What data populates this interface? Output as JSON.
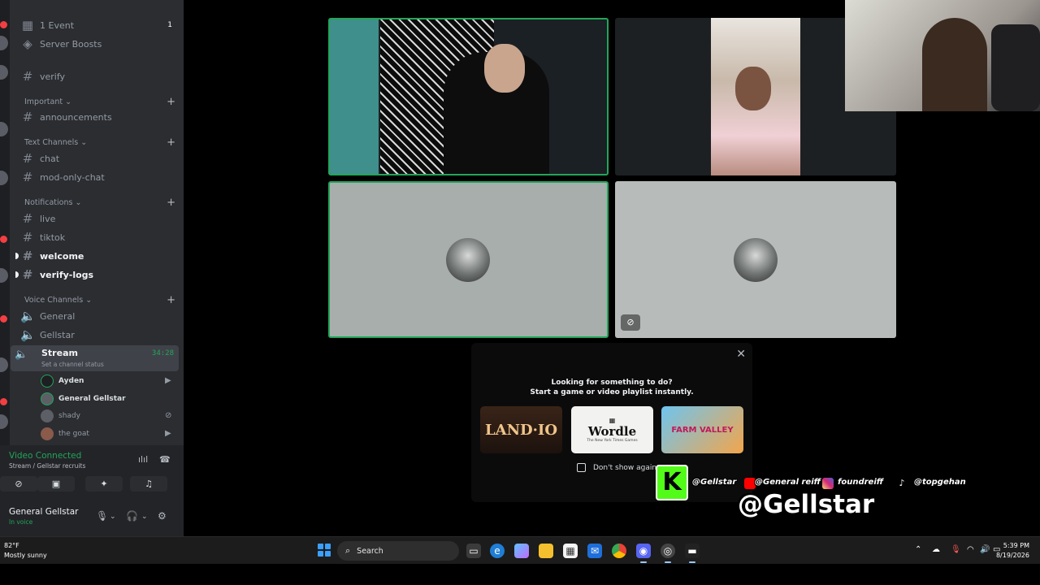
{
  "sidebar": {
    "top_items": [
      {
        "label": "1 Event",
        "count": "1"
      },
      {
        "label": "Server Boosts"
      }
    ],
    "verify": "verify",
    "categories": {
      "important": "Important",
      "text": "Text Channels",
      "notifications": "Notifications",
      "voice": "Voice Channels"
    },
    "channels": {
      "announcements": "announcements",
      "chat": "chat",
      "mod_only": "mod-only-chat",
      "live": "live",
      "tiktok": "tiktok",
      "welcome": "welcome",
      "verify_logs": "verify-logs"
    },
    "voice_channels": [
      "General",
      "Gellstar"
    ],
    "active_voice": {
      "name": "Stream",
      "status": "Set a channel status",
      "timer": "34:28"
    },
    "members": [
      "Ayden",
      "General Gellstar",
      "shady",
      "the goat"
    ]
  },
  "voice_panel": {
    "title": "Video Connected",
    "subtitle": "Stream / Gellstar recruits"
  },
  "user": {
    "name": "General Gellstar",
    "status": "In voice"
  },
  "activity": {
    "line1": "Looking for something to do?",
    "line2": "Start a game or video playlist instantly.",
    "games": {
      "land": "LAND·IO",
      "wordle": "Wordle",
      "wordle_sub": "The New York Times Games",
      "farm": "FARM VALLEY"
    },
    "dont_show": "Don't show again"
  },
  "overlay": {
    "kick_letter": "K",
    "kick_handle": "@Gellstar",
    "youtube_handle": "@General reiff",
    "instagram_handle": "foundreiff",
    "tiktok_handle": "@topgehan",
    "big_handle": "@Gellstar"
  },
  "taskbar": {
    "weather_temp": "82°F",
    "weather_desc": "Mostly sunny",
    "search_label": "Search",
    "time": "5:39 PM",
    "date": "8/19/2026"
  },
  "colors": {
    "speaking": "#23a55a",
    "sidebar": "#2b2d31",
    "kick": "#53fc18"
  }
}
